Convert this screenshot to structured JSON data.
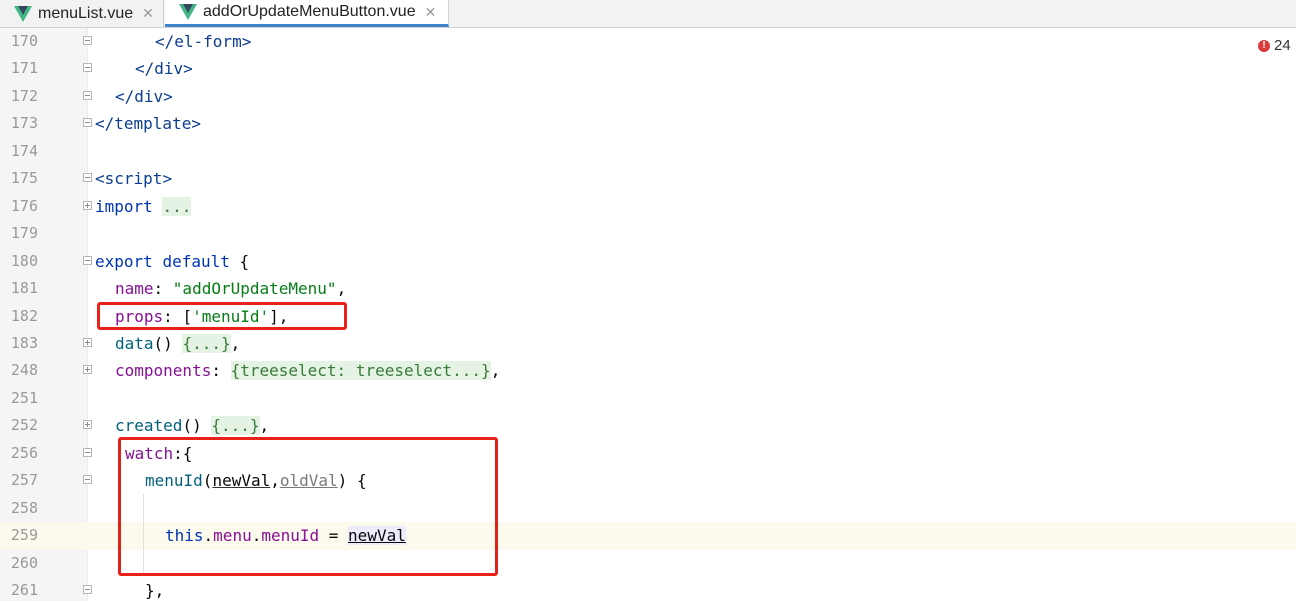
{
  "tabs": [
    {
      "label": "menuList.vue",
      "close": "✕"
    },
    {
      "label": "addOrUpdateMenuButton.vue",
      "close": "✕",
      "active": true
    }
  ],
  "error_count": "24",
  "colors": {
    "vue_green": "#41b883",
    "vue_dark": "#35495e",
    "annotation": "#e8211b",
    "active_tab": "#4083c9"
  },
  "lines": [
    {
      "num": "170",
      "t1": "</",
      "t2": "el-form",
      "t3": ">"
    },
    {
      "num": "171",
      "t1": "</",
      "t2": "div",
      "t3": ">"
    },
    {
      "num": "172",
      "t1": "</",
      "t2": "div",
      "t3": ">"
    },
    {
      "num": "173",
      "t1": "</",
      "t2": "template",
      "t3": ">"
    },
    {
      "num": "174"
    },
    {
      "num": "175",
      "t1": "<",
      "t2": "script",
      "t3": ">"
    },
    {
      "num": "176",
      "kw": "import",
      "fold": "..."
    },
    {
      "num": "179"
    },
    {
      "num": "180",
      "kw": "export",
      "kw2": "default",
      "brace": "{"
    },
    {
      "num": "181",
      "prop": "name",
      "sep": ": ",
      "str": "\"addOrUpdateMenu\"",
      "end": ","
    },
    {
      "num": "182",
      "prop": "props",
      "sep": ": [",
      "str": "'menuId'",
      "end": "],"
    },
    {
      "num": "183",
      "fn": "data",
      "sep": "() ",
      "fold": "{...}",
      "end": ","
    },
    {
      "num": "248",
      "prop": "components",
      "sep": ": ",
      "fold": "{treeselect: treeselect...}",
      "end": ","
    },
    {
      "num": "251"
    },
    {
      "num": "252",
      "fn": "created",
      "sep": "() ",
      "fold": "{...}",
      "end": ","
    },
    {
      "num": "256",
      "prop": "watch",
      "sep": ":{"
    },
    {
      "num": "257",
      "fn": "menuId",
      "p1": "newVal",
      "comma": ",",
      "p2": "oldVal",
      "end": ") {"
    },
    {
      "num": "258"
    },
    {
      "num": "259",
      "thisk": "this",
      "dot1": ".",
      "mem1": "menu",
      "dot2": ".",
      "mem2": "menuId",
      "eq": " = ",
      "v": "newVal"
    },
    {
      "num": "260"
    },
    {
      "num": "261",
      "end": "},"
    }
  ]
}
